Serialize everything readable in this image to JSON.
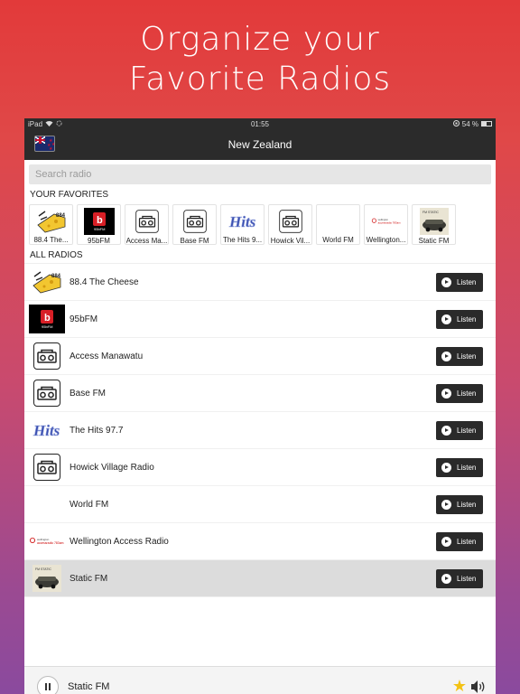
{
  "promo": {
    "line1": "Organize your",
    "line2": "Favorite Radios"
  },
  "status": {
    "device": "iPad",
    "time": "01:55",
    "battery": "54 %",
    "battery_level": 0.54
  },
  "navbar": {
    "title": "New Zealand"
  },
  "search": {
    "placeholder": "Search radio",
    "value": ""
  },
  "favorites": {
    "title": "YOUR FAVORITES",
    "items": [
      {
        "label": "88.4 The...",
        "icon": "cheese-logo"
      },
      {
        "label": "95bFM",
        "icon": "bfm-logo"
      },
      {
        "label": "Access Ma...",
        "icon": "boombox-icon"
      },
      {
        "label": "Base FM",
        "icon": "boombox-icon"
      },
      {
        "label": "The Hits 9...",
        "icon": "hits-logo"
      },
      {
        "label": "Howick Vil...",
        "icon": "boombox-icon"
      },
      {
        "label": "World FM",
        "icon": "none"
      },
      {
        "label": "Wellington...",
        "icon": "wellington-logo"
      },
      {
        "label": "Static FM",
        "icon": "static-logo"
      }
    ]
  },
  "all": {
    "title": "ALL RADIOS",
    "listen_label": "Listen",
    "items": [
      {
        "name": "88.4 The Cheese",
        "icon": "cheese-logo"
      },
      {
        "name": "95bFM",
        "icon": "bfm-logo"
      },
      {
        "name": "Access Manawatu",
        "icon": "boombox-icon"
      },
      {
        "name": "Base FM",
        "icon": "boombox-icon"
      },
      {
        "name": "The Hits 97.7",
        "icon": "hits-logo"
      },
      {
        "name": "Howick Village Radio",
        "icon": "boombox-icon"
      },
      {
        "name": "World FM",
        "icon": "none"
      },
      {
        "name": "Wellington Access Radio",
        "icon": "wellington-logo"
      },
      {
        "name": "Static FM",
        "icon": "static-logo",
        "active": true
      }
    ]
  },
  "player": {
    "now_playing": "Static FM",
    "favorited": true
  },
  "colors": {
    "bar": "#2b2b2b",
    "listen": "#2a2a2a",
    "star": "#f3c214",
    "active_row": "#dcdcdc"
  }
}
